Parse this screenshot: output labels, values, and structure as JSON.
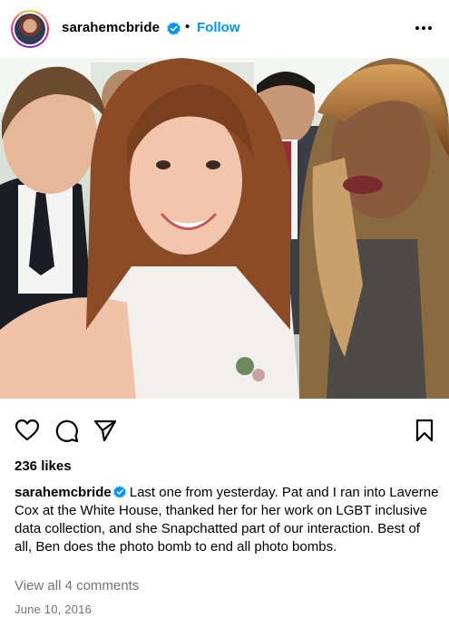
{
  "header": {
    "username": "sarahemcbride",
    "separator": "•",
    "follow_label": "Follow",
    "verified_icon": "verified-badge-icon",
    "more_icon": "more-options-icon"
  },
  "post": {
    "photo_description_icon": "post-photo",
    "likes": "236 likes",
    "caption_username": "sarahemcbride",
    "caption_text": "Last one from yesterday. Pat and I ran into Laverne Cox at the White House, thanked her for her work on LGBT inclusive data collection, and she Snapchatted part of our interaction. Best of all, Ben does the photo bomb to end all photo bombs.",
    "view_comments": "View all 4 comments",
    "date": "June 10, 2016"
  },
  "actions": {
    "like_icon": "heart-icon",
    "comment_icon": "comment-icon",
    "share_icon": "share-icon",
    "save_icon": "bookmark-icon"
  },
  "colors": {
    "accent": "#0095f6",
    "muted_text": "#737373",
    "verified": "#0095f6"
  }
}
